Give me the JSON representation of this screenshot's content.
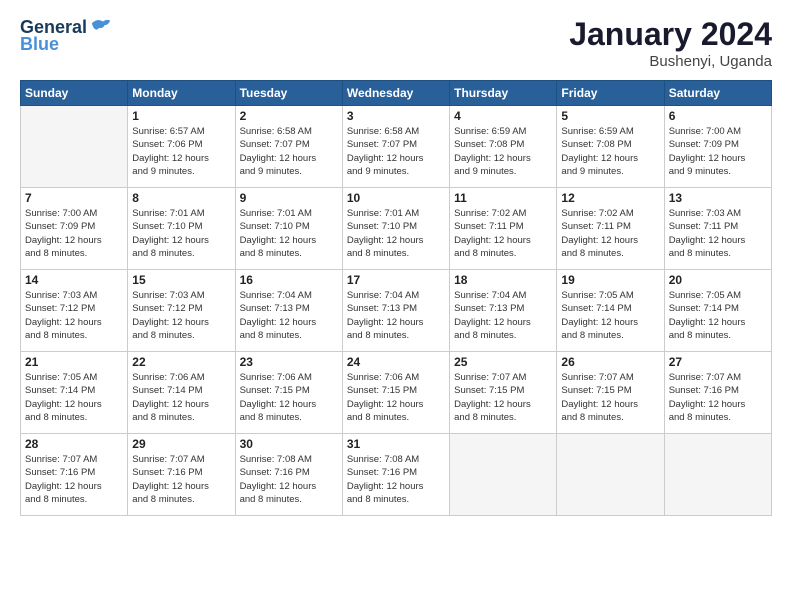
{
  "logo": {
    "line1": "General",
    "line2": "Blue"
  },
  "title": {
    "month_year": "January 2024",
    "location": "Bushenyi, Uganda"
  },
  "days_of_week": [
    "Sunday",
    "Monday",
    "Tuesday",
    "Wednesday",
    "Thursday",
    "Friday",
    "Saturday"
  ],
  "weeks": [
    [
      {
        "day": "",
        "info": ""
      },
      {
        "day": "1",
        "info": "Sunrise: 6:57 AM\nSunset: 7:06 PM\nDaylight: 12 hours\nand 9 minutes."
      },
      {
        "day": "2",
        "info": "Sunrise: 6:58 AM\nSunset: 7:07 PM\nDaylight: 12 hours\nand 9 minutes."
      },
      {
        "day": "3",
        "info": "Sunrise: 6:58 AM\nSunset: 7:07 PM\nDaylight: 12 hours\nand 9 minutes."
      },
      {
        "day": "4",
        "info": "Sunrise: 6:59 AM\nSunset: 7:08 PM\nDaylight: 12 hours\nand 9 minutes."
      },
      {
        "day": "5",
        "info": "Sunrise: 6:59 AM\nSunset: 7:08 PM\nDaylight: 12 hours\nand 9 minutes."
      },
      {
        "day": "6",
        "info": "Sunrise: 7:00 AM\nSunset: 7:09 PM\nDaylight: 12 hours\nand 9 minutes."
      }
    ],
    [
      {
        "day": "7",
        "info": "Sunrise: 7:00 AM\nSunset: 7:09 PM\nDaylight: 12 hours\nand 8 minutes."
      },
      {
        "day": "8",
        "info": "Sunrise: 7:01 AM\nSunset: 7:10 PM\nDaylight: 12 hours\nand 8 minutes."
      },
      {
        "day": "9",
        "info": "Sunrise: 7:01 AM\nSunset: 7:10 PM\nDaylight: 12 hours\nand 8 minutes."
      },
      {
        "day": "10",
        "info": "Sunrise: 7:01 AM\nSunset: 7:10 PM\nDaylight: 12 hours\nand 8 minutes."
      },
      {
        "day": "11",
        "info": "Sunrise: 7:02 AM\nSunset: 7:11 PM\nDaylight: 12 hours\nand 8 minutes."
      },
      {
        "day": "12",
        "info": "Sunrise: 7:02 AM\nSunset: 7:11 PM\nDaylight: 12 hours\nand 8 minutes."
      },
      {
        "day": "13",
        "info": "Sunrise: 7:03 AM\nSunset: 7:11 PM\nDaylight: 12 hours\nand 8 minutes."
      }
    ],
    [
      {
        "day": "14",
        "info": "Sunrise: 7:03 AM\nSunset: 7:12 PM\nDaylight: 12 hours\nand 8 minutes."
      },
      {
        "day": "15",
        "info": "Sunrise: 7:03 AM\nSunset: 7:12 PM\nDaylight: 12 hours\nand 8 minutes."
      },
      {
        "day": "16",
        "info": "Sunrise: 7:04 AM\nSunset: 7:13 PM\nDaylight: 12 hours\nand 8 minutes."
      },
      {
        "day": "17",
        "info": "Sunrise: 7:04 AM\nSunset: 7:13 PM\nDaylight: 12 hours\nand 8 minutes."
      },
      {
        "day": "18",
        "info": "Sunrise: 7:04 AM\nSunset: 7:13 PM\nDaylight: 12 hours\nand 8 minutes."
      },
      {
        "day": "19",
        "info": "Sunrise: 7:05 AM\nSunset: 7:14 PM\nDaylight: 12 hours\nand 8 minutes."
      },
      {
        "day": "20",
        "info": "Sunrise: 7:05 AM\nSunset: 7:14 PM\nDaylight: 12 hours\nand 8 minutes."
      }
    ],
    [
      {
        "day": "21",
        "info": "Sunrise: 7:05 AM\nSunset: 7:14 PM\nDaylight: 12 hours\nand 8 minutes."
      },
      {
        "day": "22",
        "info": "Sunrise: 7:06 AM\nSunset: 7:14 PM\nDaylight: 12 hours\nand 8 minutes."
      },
      {
        "day": "23",
        "info": "Sunrise: 7:06 AM\nSunset: 7:15 PM\nDaylight: 12 hours\nand 8 minutes."
      },
      {
        "day": "24",
        "info": "Sunrise: 7:06 AM\nSunset: 7:15 PM\nDaylight: 12 hours\nand 8 minutes."
      },
      {
        "day": "25",
        "info": "Sunrise: 7:07 AM\nSunset: 7:15 PM\nDaylight: 12 hours\nand 8 minutes."
      },
      {
        "day": "26",
        "info": "Sunrise: 7:07 AM\nSunset: 7:15 PM\nDaylight: 12 hours\nand 8 minutes."
      },
      {
        "day": "27",
        "info": "Sunrise: 7:07 AM\nSunset: 7:16 PM\nDaylight: 12 hours\nand 8 minutes."
      }
    ],
    [
      {
        "day": "28",
        "info": "Sunrise: 7:07 AM\nSunset: 7:16 PM\nDaylight: 12 hours\nand 8 minutes."
      },
      {
        "day": "29",
        "info": "Sunrise: 7:07 AM\nSunset: 7:16 PM\nDaylight: 12 hours\nand 8 minutes."
      },
      {
        "day": "30",
        "info": "Sunrise: 7:08 AM\nSunset: 7:16 PM\nDaylight: 12 hours\nand 8 minutes."
      },
      {
        "day": "31",
        "info": "Sunrise: 7:08 AM\nSunset: 7:16 PM\nDaylight: 12 hours\nand 8 minutes."
      },
      {
        "day": "",
        "info": ""
      },
      {
        "day": "",
        "info": ""
      },
      {
        "day": "",
        "info": ""
      }
    ]
  ]
}
